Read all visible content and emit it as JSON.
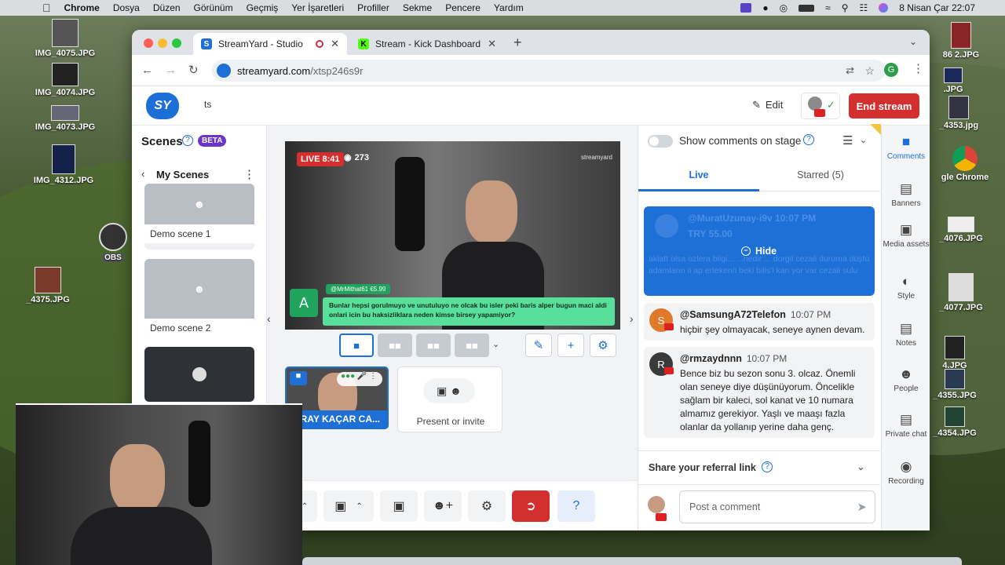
{
  "menubar": {
    "app": "Chrome",
    "items": [
      "Dosya",
      "Düzen",
      "Görünüm",
      "Geçmiş",
      "Yer İşaretleri",
      "Profiller",
      "Sekme",
      "Pencere",
      "Yardım"
    ],
    "clock": "8 Nisan Çar  22:07"
  },
  "desktop": {
    "left_icons": [
      "IMG_4075.JPG",
      "IMG_4074.JPG",
      "IMG_4073.JPG",
      "IMG_4312.JPG",
      "OBS",
      "_4375.JPG"
    ],
    "right_icons": [
      "86 2.JPG",
      ".JPG",
      "_4353.jpg",
      "gle Chrome",
      "_4076.JPG",
      "_4077.JPG",
      "4.JPG",
      "_4355.JPG",
      "_4354.JPG"
    ]
  },
  "browser": {
    "tabs": [
      {
        "title": "StreamYard - Studio",
        "active": true
      },
      {
        "title": "Stream - Kick Dashboard",
        "active": false
      }
    ],
    "url_host": "streamyard.com",
    "url_path": "/xtsp246s9r",
    "profile_initial": "G"
  },
  "app": {
    "broadcast_title": "ts",
    "edit_label": "Edit",
    "end_stream_label": "End stream",
    "scenes": {
      "title": "Scenes",
      "beta": "BETA",
      "my_scenes": "My Scenes",
      "items": [
        "Demo scene 1",
        "Demo scene 2"
      ]
    },
    "stage": {
      "live_label": "LIVE 8:41",
      "viewers": "273",
      "watermark": "streamyard",
      "overlay_avatar": "A",
      "overlay_user": "@MrMithat61  €5.99",
      "overlay_message": "Bunlar hepsi gorulmuyo ve unutuluyo ne olcak bu isler peki baris alper bugun maci aldi onlari icin bu haksizliklara neden kimse birsey yapamiyor?"
    },
    "participant_label": "GİRAY KAÇAR CA...",
    "present_label": "Present or invite",
    "comments": {
      "show_on_stage": "Show comments on stage",
      "tab_live": "Live",
      "tab_starred": "Starred (5)",
      "hidden_user": "@MuratUzunay-i9v  10:07 PM",
      "hidden_amount": "TRY 55.00",
      "hidden_text": "aklatt olsa ozlera bilgi... ...nedir ... dorgil cezali duruma düştü adamların ii ap erteken/i beki bilis'i kan yor var cezali sulu",
      "hide_label": "Hide",
      "items": [
        {
          "user": "@SamsungA72Telefon",
          "time": "10:07 PM",
          "text": "hiçbir şey olmayacak, seneye aynen devam.",
          "avatar": "S",
          "color": "#e07a2a"
        },
        {
          "user": "@rmzaydnnn",
          "time": "10:07 PM",
          "text": "Bence biz bu sezon sonu 3. olcaz. Önemli olan seneye diye düşünüyorum. Öncelikle sağlam bir kaleci, sol kanat ve 10 numara almamız gerekiyor. Yaşlı ve maaşı fazla olanlar da yollanıp yerine daha genç.",
          "avatar": "R",
          "color": "#3a3a3a"
        }
      ],
      "referral": "Share your referral link",
      "post_placeholder": "Post a comment"
    },
    "rightnav": [
      "Comments",
      "Banners",
      "Media assets",
      "Style",
      "Notes",
      "People",
      "Private chat",
      "Recording"
    ],
    "accent": "#1e6fd6",
    "end_color": "#d42f2f"
  }
}
